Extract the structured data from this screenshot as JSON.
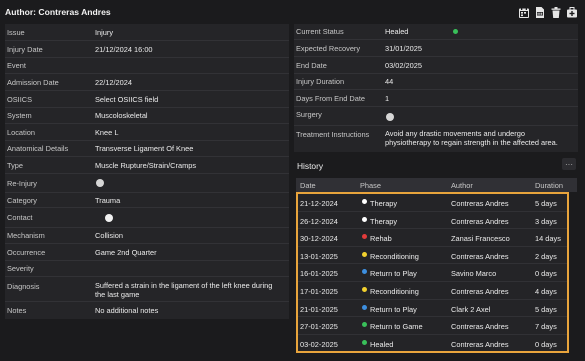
{
  "header": {
    "title": "Author: Contreras Andres"
  },
  "icons": [
    "calendar-icon",
    "file-pdf-icon",
    "trash-icon",
    "medical-bag-icon"
  ],
  "left": {
    "issue": {
      "label": "Issue",
      "value": "Injury"
    },
    "injury_date": {
      "label": "Injury Date",
      "value": "21/12/2024 16:00"
    },
    "event": {
      "label": "Event",
      "value": ""
    },
    "admission_date": {
      "label": "Admission Date",
      "value": "22/12/2024"
    },
    "osiics": {
      "label": "OSIICS",
      "value": "Select OSIICS field"
    },
    "system": {
      "label": "System",
      "value": "Muscoloskeletal"
    },
    "location": {
      "label": "Location",
      "value": "Knee L"
    },
    "anatomical_details": {
      "label": "Anatomical Details",
      "value": "Transverse Ligament Of Knee"
    },
    "type": {
      "label": "Type",
      "value": "Muscle Rupture/Strain/Cramps"
    },
    "re_injury": {
      "label": "Re-Injury",
      "on": false
    },
    "category": {
      "label": "Category",
      "value": "Trauma"
    },
    "contact": {
      "label": "Contact",
      "on": true
    },
    "mechanism": {
      "label": "Mechanism",
      "value": "Collision"
    },
    "occurrence": {
      "label": "Occurrence",
      "value": "Game 2nd Quarter"
    },
    "severity": {
      "label": "Severity",
      "value": ""
    },
    "diagnosis": {
      "label": "Diagnosis",
      "value": "Suffered a strain in the ligament of the left knee during the last game"
    },
    "notes": {
      "label": "Notes",
      "value": "No additional notes"
    }
  },
  "right": {
    "current_status": {
      "label": "Current Status",
      "value": "Healed",
      "color": "#39c05a"
    },
    "expected_recovery": {
      "label": "Expected Recovery",
      "value": "31/01/2025"
    },
    "end_date": {
      "label": "End Date",
      "value": "03/02/2025"
    },
    "injury_duration": {
      "label": "Injury Duration",
      "value": "44"
    },
    "days_from_end": {
      "label": "Days From End Date",
      "value": "1"
    },
    "surgery": {
      "label": "Surgery",
      "on": false
    },
    "treatment": {
      "label": "Treatment Instructions",
      "value": "Avoid any drastic movements and undergo physiotherapy to regain strength in the affected area."
    }
  },
  "history": {
    "title": "History",
    "more": "···",
    "columns": {
      "date": "Date",
      "phase": "Phase",
      "author": "Author",
      "duration": "Duration"
    },
    "rows": [
      {
        "date": "21-12-2024",
        "phase": "Therapy",
        "color": "#ffffff",
        "author": "Contreras Andres",
        "duration": "5 days"
      },
      {
        "date": "26-12-2024",
        "phase": "Therapy",
        "color": "#ffffff",
        "author": "Contreras Andres",
        "duration": "3 days"
      },
      {
        "date": "30-12-2024",
        "phase": "Rehab",
        "color": "#e23b3b",
        "author": "Zanasi Francesco",
        "duration": "14 days"
      },
      {
        "date": "13-01-2025",
        "phase": "Reconditioning",
        "color": "#f2d12e",
        "author": "Contreras Andres",
        "duration": "2 days"
      },
      {
        "date": "16-01-2025",
        "phase": "Return to Play",
        "color": "#3d8fe0",
        "author": "Savino Marco",
        "duration": "0 days"
      },
      {
        "date": "17-01-2025",
        "phase": "Reconditioning",
        "color": "#f2d12e",
        "author": "Contreras Andres",
        "duration": "4 days"
      },
      {
        "date": "21-01-2025",
        "phase": "Return to Play",
        "color": "#3d8fe0",
        "author": "Clark 2 Axel",
        "duration": "5 days"
      },
      {
        "date": "27-01-2025",
        "phase": "Return to Game",
        "color": "#39c05a",
        "author": "Contreras Andres",
        "duration": "7 days"
      },
      {
        "date": "03-02-2025",
        "phase": "Healed",
        "color": "#39c05a",
        "author": "Contreras Andres",
        "duration": "0 days"
      }
    ]
  }
}
